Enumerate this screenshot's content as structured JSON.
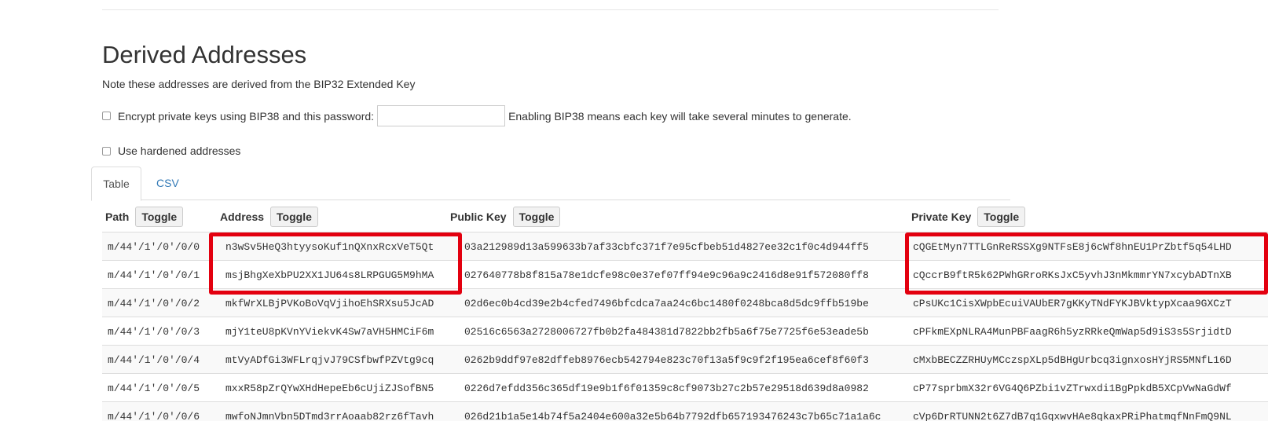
{
  "page": {
    "title": "Derived Addresses",
    "note": "Note these addresses are derived from the BIP32 Extended Key"
  },
  "options": {
    "bip38_label": "Encrypt private keys using BIP38 and this password:",
    "bip38_password_value": "",
    "bip38_hint": "Enabling BIP38 means each key will take several minutes to generate.",
    "bip38_checked": false,
    "hardened_label": "Use hardened addresses",
    "hardened_checked": false
  },
  "tabs": [
    {
      "label": "Table",
      "active": true
    },
    {
      "label": "CSV",
      "active": false
    }
  ],
  "table": {
    "columns": [
      {
        "label": "Path",
        "toggle": "Toggle"
      },
      {
        "label": "Address",
        "toggle": "Toggle"
      },
      {
        "label": "Public Key",
        "toggle": "Toggle"
      },
      {
        "label": "Private Key",
        "toggle": "Toggle"
      }
    ],
    "rows": [
      {
        "path": "m/44'/1'/0'/0/0",
        "address": "n3wSv5HeQ3htyysoKuf1nQXnxRcxVeT5Qt",
        "public_key": "03a212989d13a599633b7af33cbfc371f7e95cfbeb51d4827ee32c1f0c4d944ff5",
        "private_key": "cQGEtMyn7TTLGnReRSSXg9NTFsE8j6cWf8hnEU1PrZbtf5q54LHD"
      },
      {
        "path": "m/44'/1'/0'/0/1",
        "address": "msjBhgXeXbPU2XX1JU64s8LRPGUG5M9hMA",
        "public_key": "027640778b8f815a78e1dcfe98c0e37ef07ff94e9c96a9c2416d8e91f572080ff8",
        "private_key": "cQccrB9ftR5k62PWhGRroRKsJxC5yvhJ3nMkmmrYN7xcybADTnXB"
      },
      {
        "path": "m/44'/1'/0'/0/2",
        "address": "mkfWrXLBjPVKoBoVqVjihoEhSRXsu5JcAD",
        "public_key": "02d6ec0b4cd39e2b4cfed7496bfcdca7aa24c6bc1480f0248bca8d5dc9ffb519be",
        "private_key": "cPsUKc1CisXWpbEcuiVAUbER7gKKyTNdFYKJBVktypXcaa9GXCzT"
      },
      {
        "path": "m/44'/1'/0'/0/3",
        "address": "mjY1teU8pKVnYViekvK4Sw7aVH5HMCiF6m",
        "public_key": "02516c6563a2728006727fb0b2fa484381d7822bb2fb5a6f75e7725f6e53eade5b",
        "private_key": "cPFkmEXpNLRA4MunPBFaagR6h5yzRRkeQmWap5d9iS3s5SrjidtD"
      },
      {
        "path": "m/44'/1'/0'/0/4",
        "address": "mtVyADfGi3WFLrqjvJ79CSfbwfPZVtg9cq",
        "public_key": "0262b9ddf97e82dffeb8976ecb542794e823c70f13a5f9c9f2f195ea6cef8f60f3",
        "private_key": "cMxbBECZZRHUyMCczspXLp5dBHgUrbcq3ignxosHYjRS5MNfL16D"
      },
      {
        "path": "m/44'/1'/0'/0/5",
        "address": "mxxR58pZrQYwXHdHepeEb6cUjiZJSofBN5",
        "public_key": "0226d7efdd356c365df19e9b1f6f01359c8cf9073b27c2b57e29518d639d8a0982",
        "private_key": "cP77sprbmX32r6VG4Q6PZbi1vZTrwxdi1BgPpkdB5XCpVwNaGdWf"
      },
      {
        "path": "m/44'/1'/0'/0/6",
        "address": "mwfoNJmnVbn5DTmd3rrAoaab82rz6fTavh",
        "public_key": "026d21b1a5e14b74f5a2404e600a32e5b64b7792dfb657193476243c7b65c71a1a6c",
        "private_key": "cVp6DrRTUNN2t6Z7dB7q1GqxwvHAe8qkaxPRiPhatmqfNnFmQ9NL"
      }
    ]
  },
  "highlights": {
    "color": "#e3000f"
  }
}
